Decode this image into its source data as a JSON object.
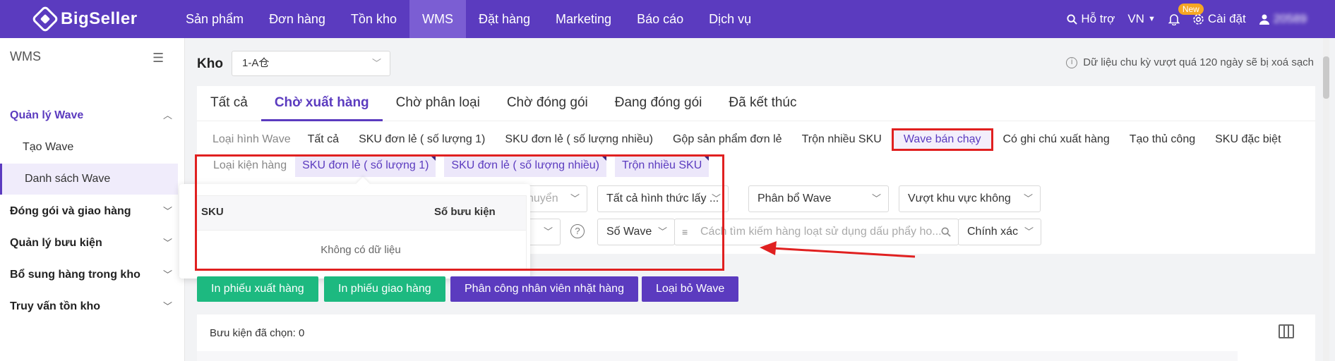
{
  "brand": "BigSeller",
  "nav": [
    "Sản phẩm",
    "Đơn hàng",
    "Tồn kho",
    "WMS",
    "Đặt hàng",
    "Marketing",
    "Báo cáo",
    "Dịch vụ"
  ],
  "nav_active": "WMS",
  "top_right": {
    "help": "Hỗ trợ",
    "lang": "VN",
    "new_badge": "New",
    "settings": "Cài đặt",
    "user": "20589"
  },
  "sidebar": {
    "title": "WMS",
    "groups": [
      {
        "label": "Quản lý Wave",
        "open": true,
        "children": [
          "Tạo Wave",
          "Danh sách Wave"
        ]
      },
      {
        "label": "Đóng gói và giao hàng"
      },
      {
        "label": "Quản lý bưu kiện"
      },
      {
        "label": "Bổ sung hàng trong kho"
      },
      {
        "label": "Truy vấn tồn kho"
      }
    ],
    "active_child": "Danh sách Wave"
  },
  "warehouse": {
    "label": "Kho",
    "value": "1-A仓"
  },
  "notice": "Dữ liệu chu kỳ vượt quá 120 ngày sẽ bị xoá sạch",
  "tabs": [
    "Tất cả",
    "Chờ xuất hàng",
    "Chờ phân loại",
    "Chờ đóng gói",
    "Đang đóng gói",
    "Đã kết thúc"
  ],
  "tab_active": "Chờ xuất hàng",
  "wave_type": {
    "label": "Loại hình Wave",
    "options": [
      "Tất cả",
      "SKU đơn lẻ ( số lượng 1)",
      "SKU đơn lẻ ( số lượng nhiều)",
      "Gộp sản phẩm đơn lẻ",
      "Trộn nhiều SKU",
      "Wave bán chạy",
      "Có ghi chú xuất hàng",
      "Tạo thủ công",
      "SKU đặc biệt"
    ],
    "highlighted": "Wave bán chạy"
  },
  "package_type": {
    "label": "Loại kiện hàng",
    "tags": [
      "SKU đơn lẻ ( số lượng 1)",
      "SKU đơn lẻ ( số lượng nhiều)",
      "Trộn nhiều SKU"
    ]
  },
  "popup_table": {
    "col_sku": "SKU",
    "col_packages": "Số bưu kiện",
    "empty": "Không có dữ liệu"
  },
  "filters": {
    "transfer_partial": "chuyển",
    "pick_method": "Tất cả hình thức lấy ...",
    "allocate": "Phân bổ Wave",
    "exceed_zone": "Vượt khu vực không",
    "search_field": "Số Wave",
    "search_placeholder": "Cách tìm kiếm hàng loạt sử dụng dấu phẩy ho...",
    "match_mode": "Chính xác"
  },
  "buttons": {
    "print_outbound": "In phiếu xuất hàng",
    "print_delivery": "In phiếu giao hàng",
    "assign_picker": "Phân công nhân viên nhặt hàng",
    "remove_wave": "Loại bỏ Wave"
  },
  "selected_count": "Bưu kiện đã chọn: 0",
  "colors": {
    "brand": "#5b3bbf",
    "green": "#1db980",
    "annotation_red": "#e02020"
  }
}
